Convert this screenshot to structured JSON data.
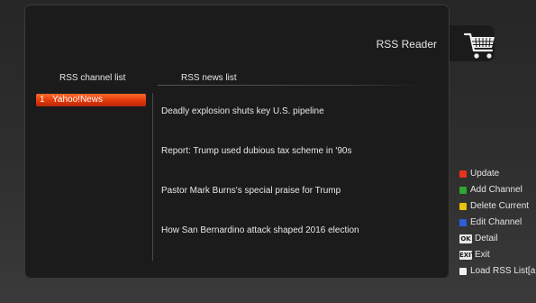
{
  "header": {
    "title": "RSS Reader",
    "icon": "shopping-cart-icon"
  },
  "channels": {
    "header": "RSS channel list",
    "items": [
      {
        "num": "1",
        "name": "Yahoo!News",
        "selected": true
      }
    ]
  },
  "news": {
    "header": "RSS news list",
    "items": [
      "Deadly explosion shuts key U.S. pipeline",
      "Report: Trump used dubious tax scheme in '90s",
      "Pastor Mark Burns's special praise for Trump",
      "How San Bernardino attack shaped 2016 election"
    ]
  },
  "legend": [
    {
      "key": "red",
      "color": "#e8321a",
      "label": "Update"
    },
    {
      "key": "green",
      "color": "#2fa830",
      "label": "Add Channel"
    },
    {
      "key": "yellow",
      "color": "#e8c20c",
      "label": "Delete Current"
    },
    {
      "key": "blue",
      "color": "#2a5fd8",
      "label": "Edit Channel"
    },
    {
      "key": "OK",
      "badge": "OK",
      "label": "Detail"
    },
    {
      "key": "EXIT",
      "badge": "EXIT",
      "label": "Exit"
    },
    {
      "key": "white",
      "color": "#f0f0f0",
      "label": "Load RSS List[a"
    }
  ]
}
